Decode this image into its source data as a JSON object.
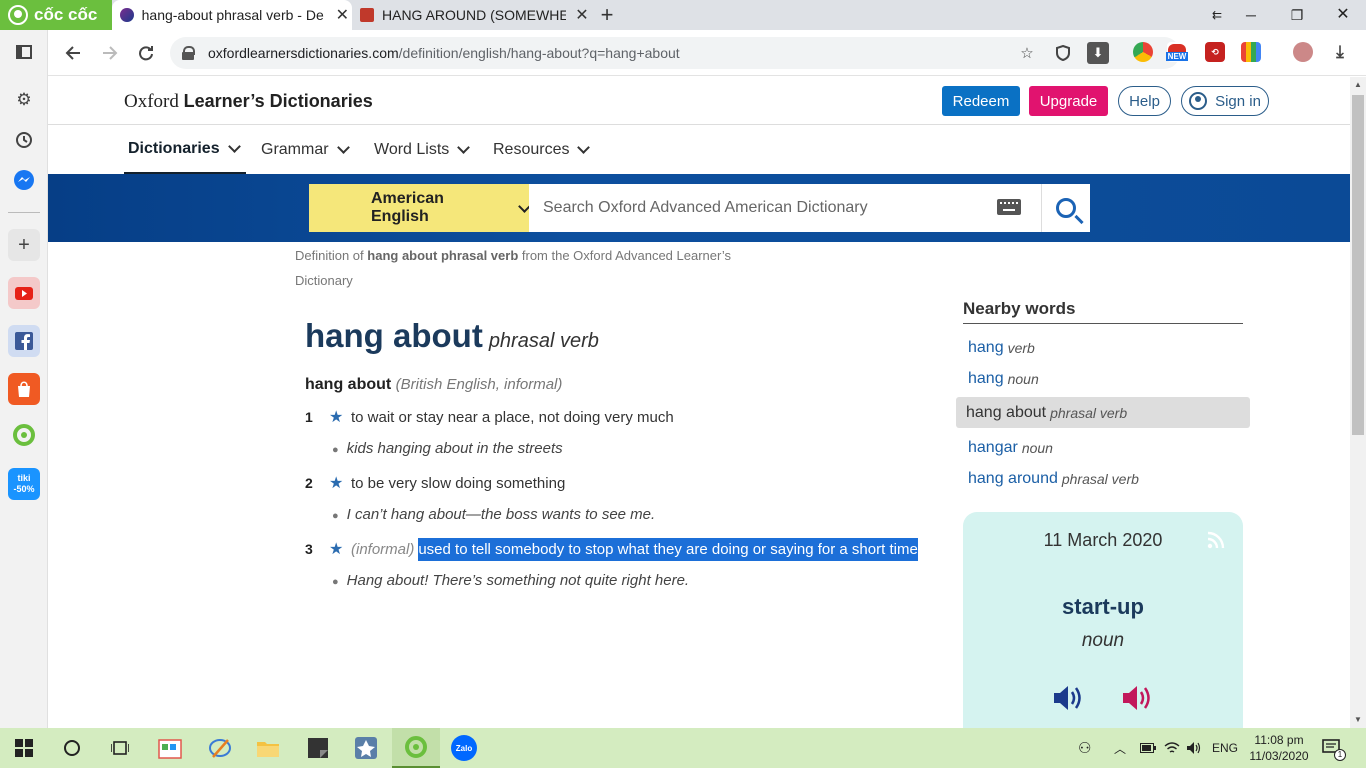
{
  "browser": {
    "brand": "cốc cốc",
    "tabs": [
      {
        "title": "hang-about phrasal verb - De",
        "close": "✕"
      },
      {
        "title": "HANG AROUND (SOMEWHER",
        "close": "✕"
      }
    ],
    "new_tab": "+",
    "window_controls": {
      "minimize": "─",
      "restore": "❐",
      "close": "✕"
    },
    "address": {
      "host": "oxfordlearnersdictionaries.com",
      "path": "/definition/english/hang-about?q=hang+about"
    },
    "extensions": [
      {
        "name": "new-badge",
        "label": "NEW",
        "color": "#d93025"
      }
    ],
    "sidebar_icons": [
      "panel-icon",
      "settings-gear-icon",
      "history-icon",
      "messenger-icon",
      "add-icon",
      "youtube-icon",
      "facebook-icon",
      "shopee-icon",
      "coccoc-icon",
      "tiki-icon"
    ],
    "tiki_badge": {
      "top": "tiki",
      "bottom": "-50%"
    }
  },
  "site": {
    "logo": {
      "oxford": "Oxford",
      "rest": "Learner’s Dictionaries"
    },
    "buttons": {
      "redeem": "Redeem",
      "upgrade": "Upgrade",
      "help": "Help",
      "sign_in": "Sign in"
    },
    "colors": {
      "redeem": "#0a71c4",
      "upgrade": "#e1136f",
      "band": "#0b4a96",
      "select": "#f5e77a"
    },
    "nav": [
      {
        "label": "Dictionaries",
        "active": true
      },
      {
        "label": "Grammar",
        "active": false
      },
      {
        "label": "Word Lists",
        "active": false
      },
      {
        "label": "Resources",
        "active": false
      }
    ],
    "search": {
      "dictionary": "American English",
      "placeholder": "Search Oxford Advanced American Dictionary"
    }
  },
  "entry": {
    "definition_of": {
      "prefix": "Definition of",
      "term": "hang about phrasal verb",
      "suffix": "from the Oxford Advanced Learner’s Dictionary"
    },
    "headword": "hang about",
    "pos": "phrasal verb",
    "phrase": "hang about",
    "phrase_labels": "(British English, informal)",
    "senses": [
      {
        "num": "1",
        "label": "",
        "def": "to wait or stay near a place, not doing very much",
        "example": "kids hanging about in the streets"
      },
      {
        "num": "2",
        "label": "",
        "def": "to be very slow doing something",
        "example": "I can’t hang about—the boss wants to see me."
      },
      {
        "num": "3",
        "label": "(informal)",
        "def": "used to tell somebody to stop what they are doing or saying for a short time",
        "example": "Hang about! There’s something not quite right here."
      }
    ]
  },
  "nearby": {
    "title": "Nearby words",
    "items": [
      {
        "word": "hang",
        "pos": "verb",
        "current": false
      },
      {
        "word": "hang",
        "pos": "noun",
        "current": false
      },
      {
        "word": "hang about",
        "pos": "phrasal verb",
        "current": true
      },
      {
        "word": "hangar",
        "pos": "noun",
        "current": false
      },
      {
        "word": "hang around",
        "pos": "phrasal verb",
        "current": false
      }
    ]
  },
  "word_of_the_day": {
    "date": "11 March 2020",
    "word": "start-up",
    "pos": "noun"
  },
  "taskbar": {
    "language": "ENG",
    "time": "11:08 pm",
    "date": "11/03/2020",
    "notification_count": "1",
    "zalo": "Zalo"
  }
}
